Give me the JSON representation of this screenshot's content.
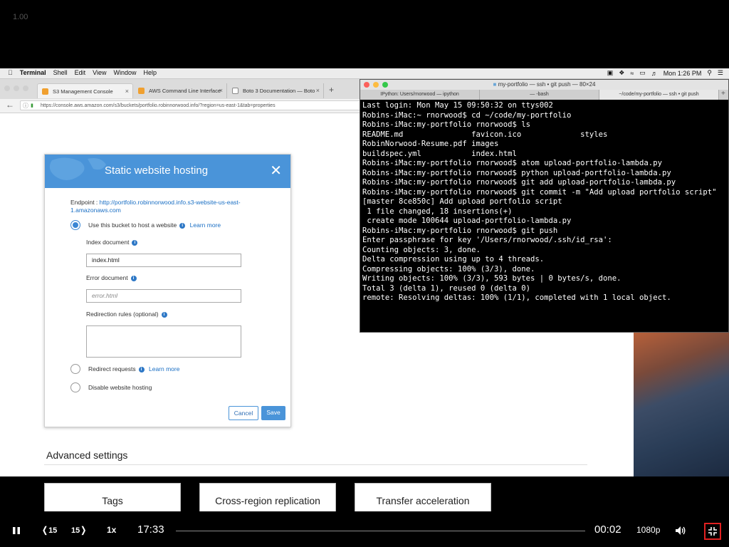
{
  "zoom_label": "1.00",
  "menubar": {
    "apple": "",
    "items": [
      "Terminal",
      "Shell",
      "Edit",
      "View",
      "Window",
      "Help"
    ],
    "clock": "Mon 1:26 PM"
  },
  "browser": {
    "tabs": [
      {
        "label": "S3 Management Console",
        "color": "#f0a030"
      },
      {
        "label": "AWS Command Line Interface",
        "color": "#f0a030"
      },
      {
        "label": "Boto 3 Documentation — Boto",
        "color": "#888888"
      }
    ],
    "url": "https://console.aws.amazon.com/s3/buckets/portfolio.robinnorwood.info/?region=us-east-1&tab=properties",
    "url_host": "console.aws.amazon.com"
  },
  "modal": {
    "title": "Static website hosting",
    "endpoint_label": "Endpoint :",
    "endpoint_url": "http://portfolio.robinnorwood.info.s3-website-us-east-1.amazonaws.com",
    "option_host": "Use this bucket to host a website",
    "learn_more": "Learn more",
    "index_label": "Index document",
    "index_value": "index.html",
    "error_label": "Error document",
    "error_placeholder": "error.html",
    "redirection_label": "Redirection rules (optional)",
    "option_redirect": "Redirect requests",
    "option_disable": "Disable website hosting",
    "cancel": "Cancel",
    "save": "Save"
  },
  "advanced": {
    "heading": "Advanced settings",
    "cards": [
      "Tags",
      "Cross-region replication",
      "Transfer acceleration"
    ]
  },
  "terminal": {
    "title": "my-portfolio — ssh • git push — 80×24",
    "tabs": [
      "IPython: Users/rnorwood — ipython",
      "— -bash",
      "~/code/my-portfolio — ssh • git push"
    ],
    "lines": [
      "Last login: Mon May 15 09:50:32 on ttys002",
      "Robins-iMac:~ rnorwood$ cd ~/code/my-portfolio",
      "Robins-iMac:my-portfolio rnorwood$ ls",
      "README.md               favicon.ico             styles",
      "RobinNorwood-Resume.pdf images",
      "buildspec.yml           index.html",
      "Robins-iMac:my-portfolio rnorwood$ atom upload-portfolio-lambda.py",
      "Robins-iMac:my-portfolio rnorwood$ python upload-portfolio-lambda.py",
      "Robins-iMac:my-portfolio rnorwood$ git add upload-portfolio-lambda.py",
      "Robins-iMac:my-portfolio rnorwood$ git commit -m \"Add upload portfolio script\"",
      "[master 8ce850c] Add upload portfolio script",
      " 1 file changed, 18 insertions(+)",
      " create mode 100644 upload-portfolio-lambda.py",
      "Robins-iMac:my-portfolio rnorwood$ git push",
      "Enter passphrase for key '/Users/rnorwood/.ssh/id_rsa':",
      "Counting objects: 3, done.",
      "Delta compression using up to 4 threads.",
      "Compressing objects: 100% (3/3), done.",
      "Writing objects: 100% (3/3), 593 bytes | 0 bytes/s, done.",
      "Total 3 (delta 1), reused 0 (delta 0)",
      "remote: Resolving deltas: 100% (1/1), completed with 1 local object."
    ]
  },
  "player": {
    "back_label": "15",
    "fwd_label": "15",
    "speed": "1x",
    "remaining": "17:33",
    "elapsed": "00:02",
    "quality": "1080p",
    "progress": 0
  }
}
